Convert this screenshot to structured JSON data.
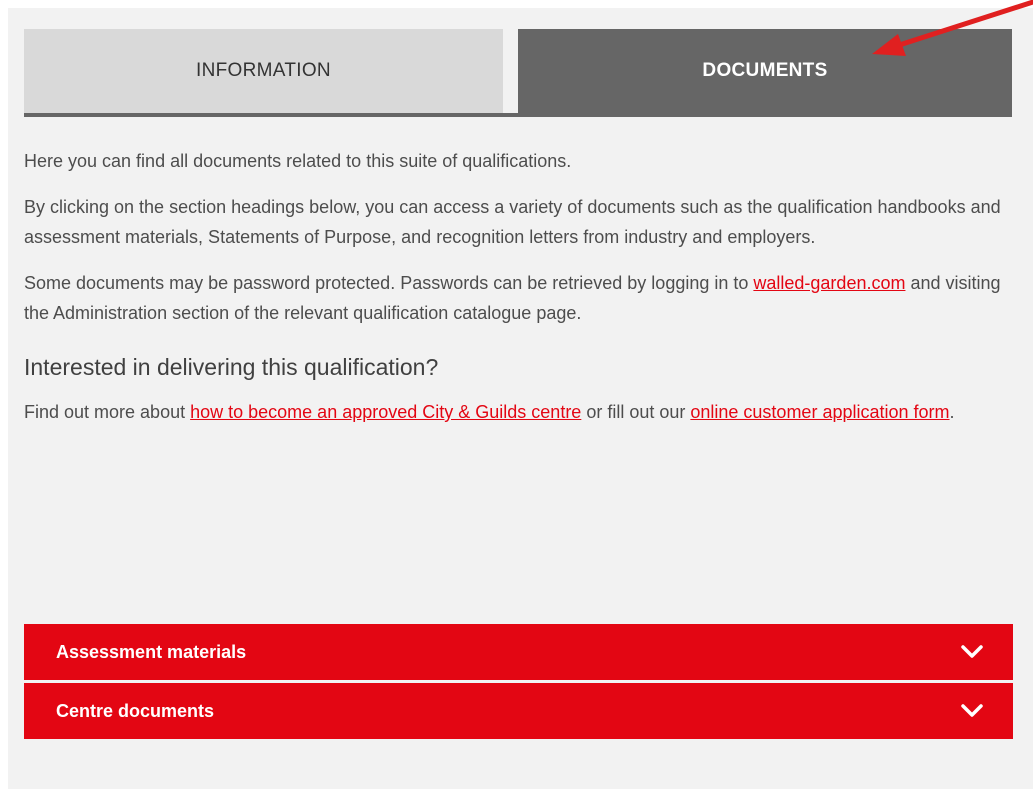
{
  "tabs": {
    "information_label": "INFORMATION",
    "documents_label": "DOCUMENTS",
    "active": "DOCUMENTS"
  },
  "content": {
    "intro": "Here you can find all documents related to this suite of qualifications.",
    "para2": "By clicking on the section headings below, you can access a variety of documents such as the qualification handbooks and assessment materials, Statements of Purpose, and recognition letters from industry and employers.",
    "para3_before": "Some documents may be password protected. Passwords can be retrieved by logging in to ",
    "para3_link": "walled-garden.com",
    "para3_after": " and visiting the Administration section of the relevant qualification catalogue page.",
    "heading": "Interested in delivering this qualification?",
    "para4_before": "Find out more about ",
    "para4_link1": "how to become an approved City & Guilds centre",
    "para4_middle": " or fill out our ",
    "para4_link2": "online customer application form",
    "para4_after": "."
  },
  "accordion": {
    "items": [
      {
        "label": "Assessment materials",
        "icon": "chevron-down-icon"
      },
      {
        "label": "Centre documents",
        "icon": "chevron-down-icon"
      }
    ]
  },
  "colors": {
    "accent_red": "#e30613",
    "active_tab": "#666666",
    "inactive_tab": "#d9d9d9",
    "panel_bg": "#f2f2f2",
    "annotation_arrow": "#e02020"
  }
}
